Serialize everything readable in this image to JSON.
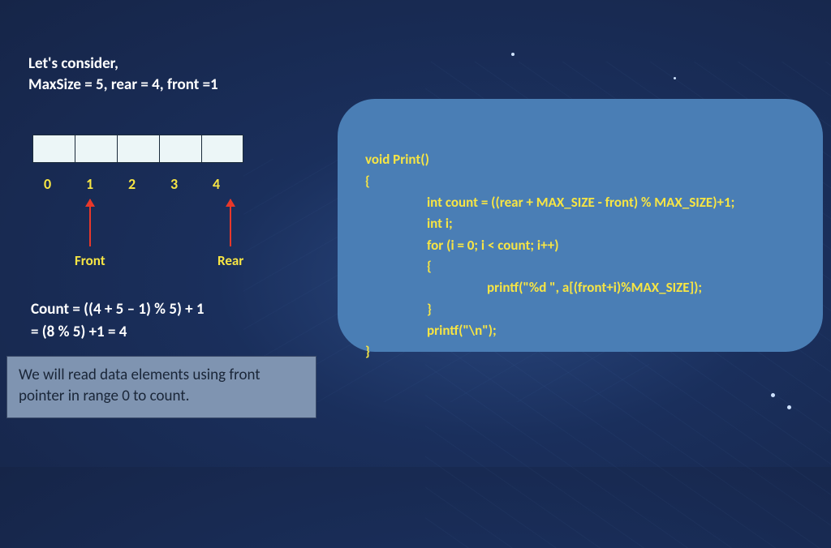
{
  "intro": {
    "line1": "Let's consider,",
    "line2": "MaxSize = 5, rear = 4, front =1"
  },
  "array": {
    "indices": [
      "0",
      "1",
      "2",
      "3",
      "4"
    ],
    "front_label": "Front",
    "rear_label": "Rear"
  },
  "count_calc": {
    "line1": "Count = ((4 + 5 – 1) % 5) + 1",
    "line2": "           = (8 % 5) +1 = 4"
  },
  "note": "We will read data elements using front pointer in range 0 to count.",
  "code": {
    "l1": "void Print()",
    "l2": "{",
    "l3": "int count = ((rear + MAX_SIZE - front) % MAX_SIZE)+1;",
    "l4": "int i;",
    "l5": "for (i = 0; i < count; i++)",
    "l6": "{",
    "l7": "printf(\"%d \", a[(front+i)%MAX_SIZE]);",
    "l8": "}",
    "l9": "printf(\"\\n\");",
    "l10": "}"
  }
}
